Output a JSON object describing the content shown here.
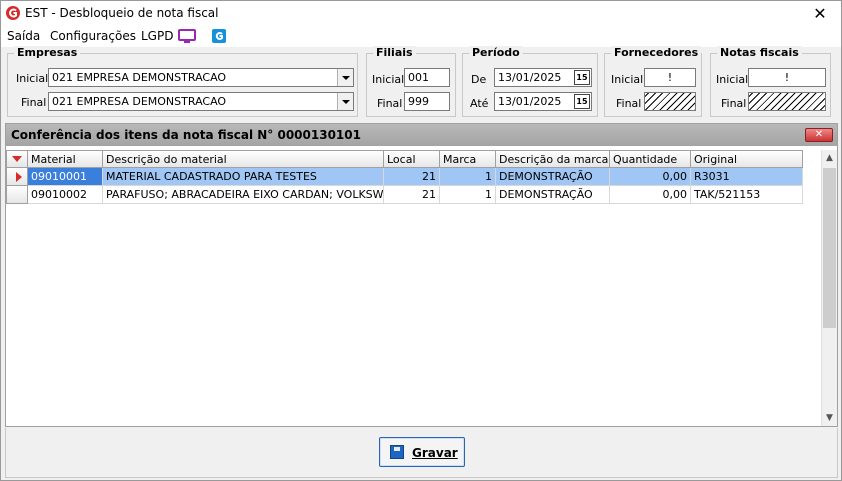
{
  "window": {
    "title": "EST - Desbloqueio de nota fiscal",
    "close_glyph": "✕"
  },
  "menu": {
    "items": [
      "Saída",
      "Configurações",
      "LGPD"
    ]
  },
  "filters": {
    "empresas": {
      "title": "Empresas",
      "inicial_label": "Inicial",
      "final_label": "Final",
      "inicial_value": "021 EMPRESA DEMONSTRACAO",
      "final_value": "021 EMPRESA DEMONSTRACAO"
    },
    "filiais": {
      "title": "Filiais",
      "inicial_label": "Inicial",
      "final_label": "Final",
      "inicial_value": "001",
      "final_value": "999"
    },
    "periodo": {
      "title": "Período",
      "de_label": "De",
      "ate_label": "Até",
      "de_value": "13/01/2025",
      "ate_value": "13/01/2025",
      "cal_glyph": "15"
    },
    "fornecedores": {
      "title": "Fornecedores",
      "inicial_label": "Inicial",
      "final_label": "Final",
      "inicial_value": "!"
    },
    "notas": {
      "title": "Notas fiscais",
      "inicial_label": "Inicial",
      "final_label": "Final",
      "inicial_value": "!"
    }
  },
  "panel": {
    "title": "Conferência dos itens da nota fiscal N° 0000130101",
    "close_glyph": "✕",
    "columns": [
      "Material",
      "Descrição do material",
      "Local",
      "Marca",
      "Descrição da marca",
      "Quantidade",
      "Original"
    ],
    "rows": [
      [
        "09010001",
        "MATERIAL CADASTRADO PARA TESTES",
        "21",
        "1",
        "DEMONSTRAÇÃO",
        "0,00",
        "R3031"
      ],
      [
        "09010002",
        "PARAFUSO; ABRACADEIRA EIXO CARDAN; VOLKSW...",
        "21",
        "1",
        "DEMONSTRAÇÃO",
        "0,00",
        "TAK/521153"
      ]
    ]
  },
  "footer": {
    "save_label": "Gravar"
  },
  "colors": {
    "accent": "#2a62b4",
    "selected_row": "#9fc6f4",
    "brand_red": "#d62b2b",
    "lgpd_purple": "#9b27b0",
    "help_blue": "#1592d9"
  }
}
